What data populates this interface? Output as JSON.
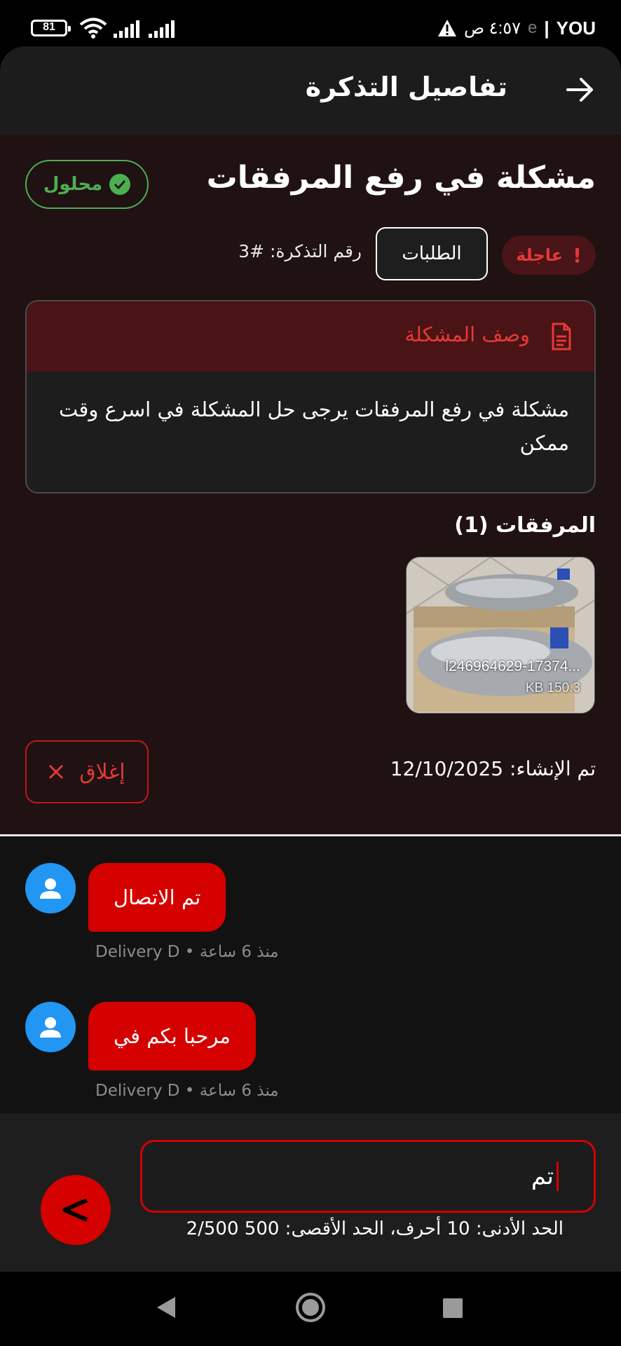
{
  "status_bar": {
    "battery": "81",
    "carrier": "YOU",
    "time": "٤:٥٧ ص",
    "faded_text": "e"
  },
  "header": {
    "title": "تفاصيل التذكرة"
  },
  "ticket": {
    "title": "مشكلة في رفع المرفقات",
    "status": "محلول",
    "priority": "عاجلة",
    "category": "الطلبات",
    "number_label": "رقم التذكرة: #3",
    "description_title": "وصف المشكلة",
    "description": "مشكلة في رفع المرفقات يرجى حل المشكلة في اسرع وقت ممكن",
    "attachments_title": "المرفقات (1)",
    "attachment": {
      "name": "l246964629-17374...",
      "size": "KB 150.3"
    },
    "close_label": "إغلاق",
    "created_label": "تم الإنشاء: 12/10/2025"
  },
  "messages": [
    {
      "text": "تم الاتصال",
      "meta": "Delivery D • منذ 6 ساعة"
    },
    {
      "text": "مرحبا بكم في",
      "meta": "Delivery D • منذ 6 ساعة"
    }
  ],
  "composer": {
    "value": "تم",
    "hint": "الحد الأدنى: 10 أحرف، الحد الأقصى: 500 2/500"
  },
  "colors": {
    "accent": "#d50000",
    "success": "#4caf50",
    "avatar": "#2196f3"
  }
}
